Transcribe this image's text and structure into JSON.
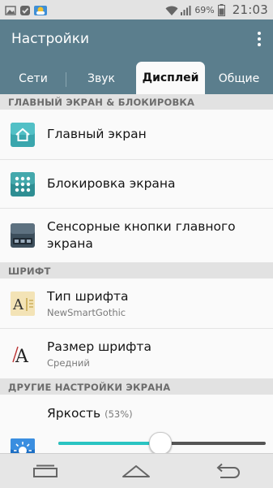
{
  "status_bar": {
    "battery_percent": "69%",
    "time": "21:03",
    "icons": [
      "gallery-icon",
      "check-icon",
      "weather-icon",
      "wifi-icon",
      "signal-icon",
      "battery-icon"
    ]
  },
  "action_bar": {
    "title": "Настройки",
    "menu_icon": "overflow-menu-icon"
  },
  "tabs": [
    {
      "label": "Сети",
      "active": false
    },
    {
      "label": "Звук",
      "active": false
    },
    {
      "label": "Дисплей",
      "active": true
    },
    {
      "label": "Общие",
      "active": false
    }
  ],
  "sections": {
    "home_lock": {
      "header": "ГЛАВНЫЙ ЭКРАН & БЛОКИРОВКА",
      "items": [
        {
          "title": "Главный экран",
          "icon": "home-icon"
        },
        {
          "title": "Блокировка экрана",
          "icon": "lock-pattern-icon"
        },
        {
          "title": "Сенсорные кнопки главного экрана",
          "icon": "touch-buttons-icon"
        }
      ]
    },
    "font": {
      "header": "ШРИФТ",
      "items": [
        {
          "title": "Тип шрифта",
          "subtitle": "NewSmartGothic",
          "icon": "font-type-icon"
        },
        {
          "title": "Размер шрифта",
          "subtitle": "Средний",
          "icon": "font-size-icon"
        }
      ]
    },
    "other": {
      "header": "ДРУГИЕ НАСТРОЙКИ ЭКРАНА",
      "brightness": {
        "title": "Яркость",
        "percent_label": "(53%)",
        "value": 0.49,
        "icon": "brightness-icon"
      }
    }
  },
  "nav_bar": {
    "icons": [
      "recent-apps-icon",
      "home-nav-icon",
      "back-icon"
    ]
  },
  "colors": {
    "accent": "#2ac4c2",
    "action_bar": "#5b7e8d"
  }
}
